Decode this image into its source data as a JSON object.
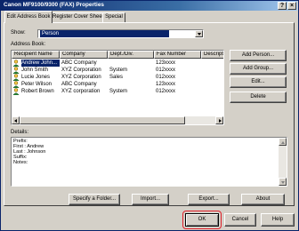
{
  "window": {
    "title": "Canon MF9100/9300 (FAX) Properties",
    "help_glyph": "?",
    "close_glyph": "×"
  },
  "tabs": [
    {
      "label": "Edit Address Book",
      "active": true
    },
    {
      "label": "Register Cover Sheet",
      "active": false
    },
    {
      "label": "Special",
      "active": false
    }
  ],
  "show": {
    "label": "Show:",
    "selected": "Person"
  },
  "address_book": {
    "label": "Address Book:",
    "columns": [
      "Recipient Name",
      "Company",
      "Dept./Div.",
      "Fax Number",
      "Descriptio"
    ],
    "rows": [
      {
        "name": "Andrew John...",
        "company": "ABC Company",
        "dept": "",
        "fax": "123xxxx",
        "selected": true
      },
      {
        "name": "John Smith",
        "company": "XYZ Corporation",
        "dept": "System",
        "fax": "012xxxx",
        "selected": false
      },
      {
        "name": "Lucie Jones",
        "company": "XYZ Corporation",
        "dept": "Sales",
        "fax": "012xxxx",
        "selected": false
      },
      {
        "name": "Peter Wilson",
        "company": "ABC Company",
        "dept": "",
        "fax": "123xxxx",
        "selected": false
      },
      {
        "name": "Robert Brown",
        "company": "XYZ corporation",
        "dept": "System",
        "fax": "012xxxx",
        "selected": false
      }
    ]
  },
  "side_buttons": {
    "add_person": "Add Person...",
    "add_group": "Add Group...",
    "edit": "Edit...",
    "delete": "Delete"
  },
  "details": {
    "label": "Details:",
    "lines": [
      "Prefix:",
      "First   : Andrew",
      "Last   : Johnson",
      "Suffix:",
      "Notes:"
    ]
  },
  "bottom_buttons": {
    "specify_folder": "Specify a Folder...",
    "import": "Import...",
    "export": "Export...",
    "about": "About"
  },
  "dialog_buttons": {
    "ok": "OK",
    "cancel": "Cancel",
    "help": "Help"
  },
  "colors": {
    "titlebar": "#0a246a",
    "selection": "#0a246a",
    "highlight": "#e0202a",
    "face": "#d4d0c8"
  }
}
